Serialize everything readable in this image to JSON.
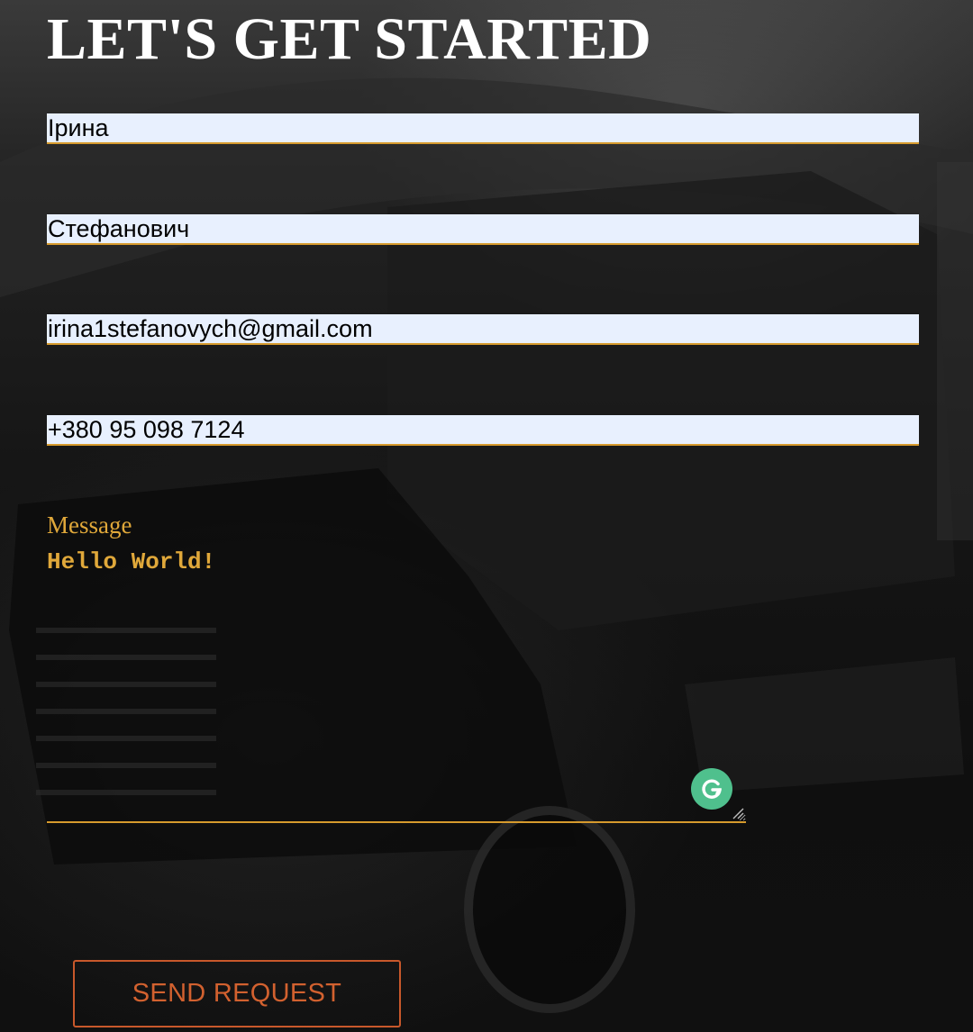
{
  "page": {
    "title": "LET'S GET STARTED"
  },
  "form": {
    "first_name": {
      "value": "Ірина"
    },
    "last_name": {
      "value": "Стефанович"
    },
    "email": {
      "value": "irina1stefanovych@gmail.com"
    },
    "phone": {
      "value": "+380 95 098 7124"
    },
    "message": {
      "label": "Message",
      "value": "Hello World!"
    },
    "submit_label": "SEND REQUEST"
  },
  "extensions": {
    "grammarly_icon": "grammarly-icon"
  },
  "colors": {
    "accent": "#d69a2d",
    "label": "#e0a83a",
    "button": "#c8582b",
    "autofill_bg": "#e8f0fe",
    "grammarly": "#4fc08d"
  }
}
